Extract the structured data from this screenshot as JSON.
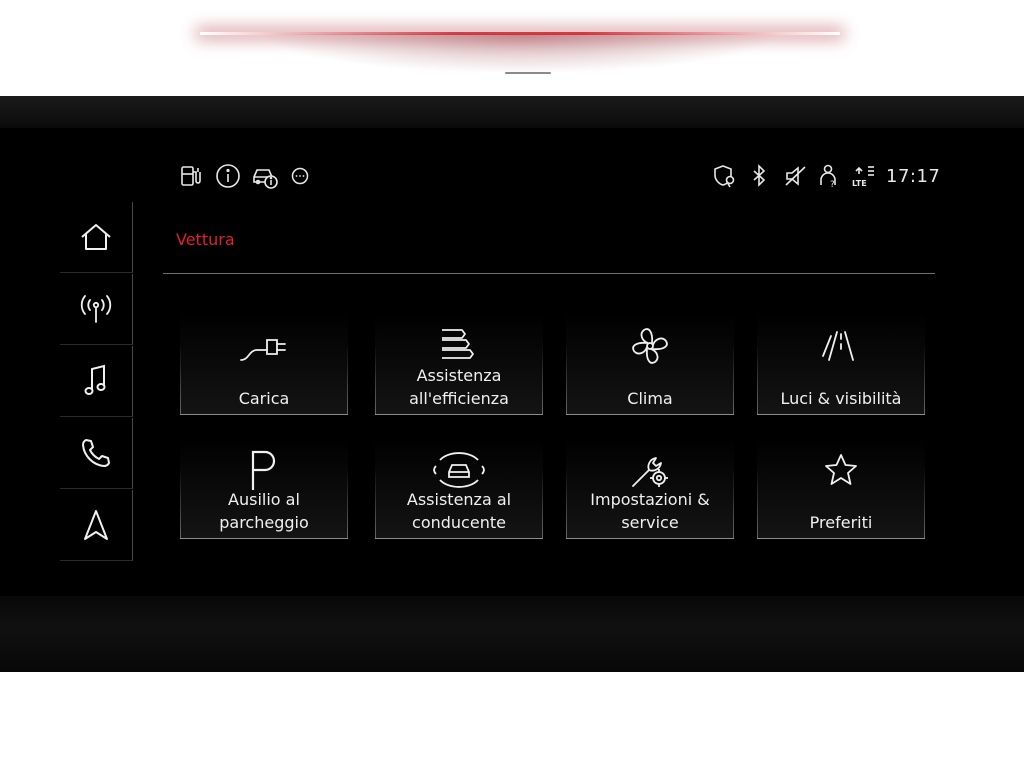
{
  "status_bar": {
    "left_icons": [
      "ev-charge-station-icon",
      "info-icon",
      "car-info-icon",
      "more-icon"
    ],
    "right_icons": [
      "shield-location-icon",
      "bluetooth-icon",
      "mute-icon",
      "person-help-icon",
      "lte-signal-icon"
    ],
    "clock": "17:17"
  },
  "sidebar": {
    "items": [
      {
        "icon": "home-icon"
      },
      {
        "icon": "radio-icon"
      },
      {
        "icon": "music-icon"
      },
      {
        "icon": "phone-icon"
      },
      {
        "icon": "navigation-icon"
      }
    ]
  },
  "page": {
    "title": "Vettura",
    "accent_color": "#e0212e"
  },
  "tiles": [
    {
      "label": "Carica",
      "icon": "charging-plug-icon"
    },
    {
      "label": "Assistenza\nall'efficienza",
      "icon": "efficiency-bars-icon"
    },
    {
      "label": "Clima",
      "icon": "fan-icon"
    },
    {
      "label": "Luci & visibilità",
      "icon": "lights-visibility-icon"
    },
    {
      "label": "Ausilio al\nparcheggio",
      "icon": "parking-icon"
    },
    {
      "label": "Assistenza al\nconducente",
      "icon": "driver-assist-icon"
    },
    {
      "label": "Impostazioni &\nservice",
      "icon": "settings-wrench-icon"
    },
    {
      "label": "Preferiti",
      "icon": "star-icon"
    }
  ]
}
